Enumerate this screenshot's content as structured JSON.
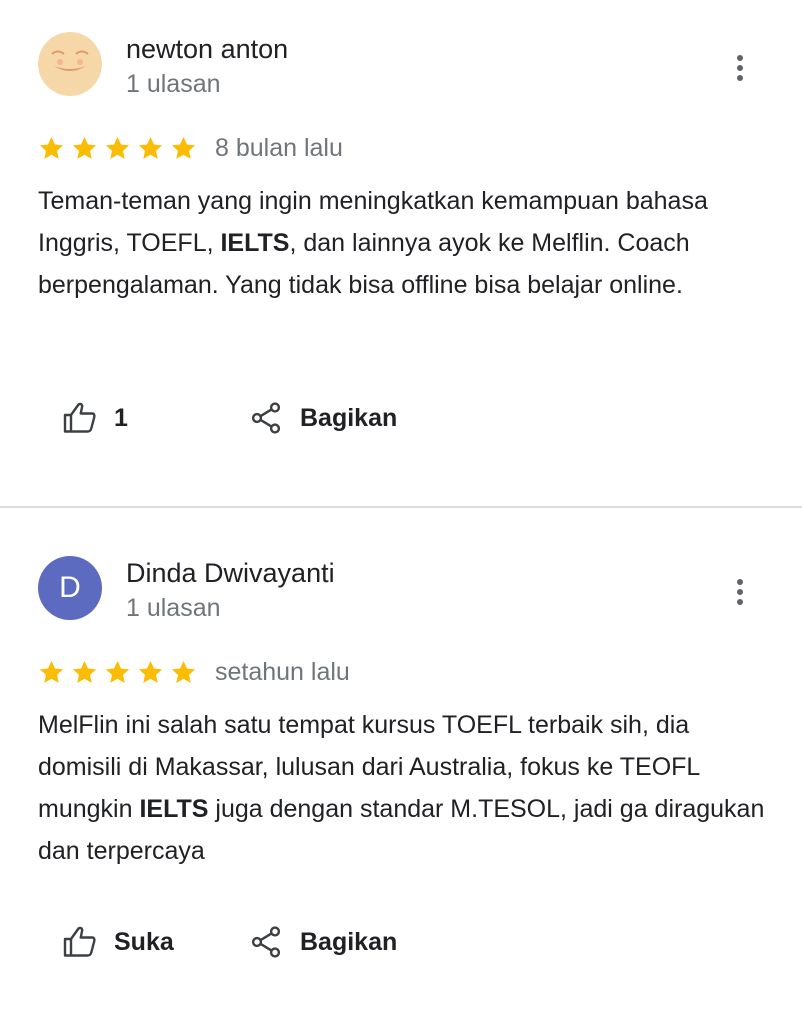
{
  "reviews": [
    {
      "reviewer": "newton anton",
      "review_count": "1 ulasan",
      "rating": 5,
      "date": "8 bulan lalu",
      "text_parts": [
        {
          "t": "Teman-teman yang ingin meningkatkan kemampuan bahasa Inggris, TOEFL, ",
          "bold": false
        },
        {
          "t": "IELTS",
          "bold": true
        },
        {
          "t": ", dan lainnya ayok ke Melflin. Coach berpengalaman. Yang tidak bisa offline bisa belajar online.",
          "bold": false
        }
      ],
      "like_label": "1",
      "share_label": "Bagikan"
    },
    {
      "reviewer": "Dinda Dwivayanti",
      "avatar_letter": "D",
      "review_count": "1 ulasan",
      "rating": 5,
      "date": "setahun lalu",
      "text_parts": [
        {
          "t": "MelFlin ini salah satu tempat kursus TOEFL terbaik sih, dia domisili di Makassar, lulusan dari Australia, fokus ke TEOFL mungkin ",
          "bold": false
        },
        {
          "t": "IELTS",
          "bold": true
        },
        {
          "t": " juga dengan standar M.TESOL, jadi ga diragukan dan terpercaya",
          "bold": false
        }
      ],
      "like_label": "Suka",
      "share_label": "Bagikan"
    }
  ],
  "colors": {
    "star": "#fbbc04",
    "avatar_bg_2": "#5c6bc0",
    "divider": "#dadce0",
    "secondary_text": "#70757a"
  },
  "icons": {
    "menu": "more-vert-icon",
    "like": "thumb-up-icon",
    "share": "share-icon",
    "star": "star-icon"
  }
}
